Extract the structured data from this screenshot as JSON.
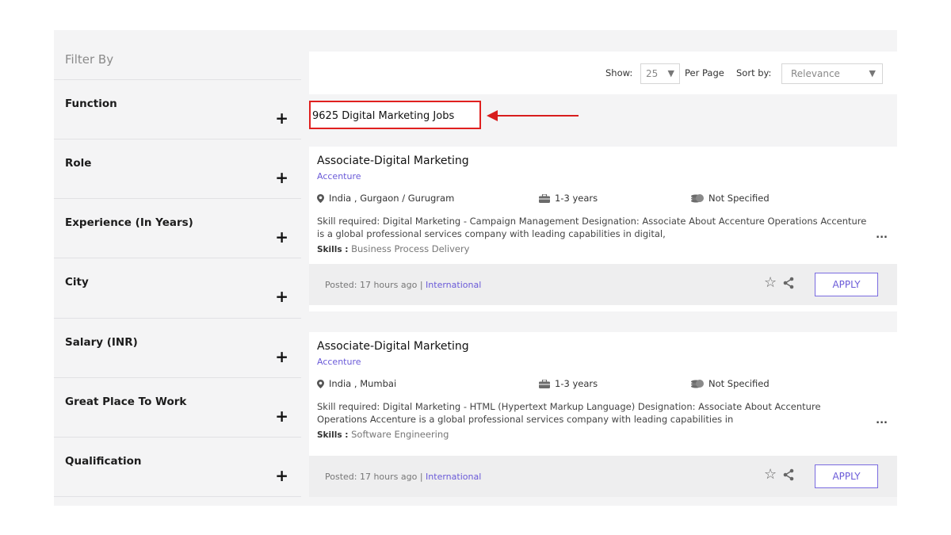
{
  "sidebar": {
    "title": "Filter By",
    "filters": [
      {
        "label": "Function"
      },
      {
        "label": "Role"
      },
      {
        "label": "Experience (In Years)"
      },
      {
        "label": "City"
      },
      {
        "label": "Salary (INR)"
      },
      {
        "label": "Great Place To Work"
      },
      {
        "label": "Qualification"
      }
    ],
    "expand_symbol": "+"
  },
  "toolbar": {
    "show_label": "Show:",
    "per_page_value": "25",
    "per_page_label": "Per Page",
    "sort_label": "Sort by:",
    "sort_value": "Relevance",
    "dropdown_arrow": "▼"
  },
  "results": {
    "count_text": "9625 Digital Marketing Jobs"
  },
  "jobs": [
    {
      "title": "Associate-Digital Marketing",
      "company": "Accenture",
      "location": "India , Gurgaon / Gurugram",
      "experience": "1-3 years",
      "salary": "Not Specified",
      "description": "Skill required: Digital Marketing - Campaign Management Designation: Associate About Accenture Operations Accenture is a global professional services company with leading capabilities in digital,",
      "skills_label": "Skills :",
      "skills": "Business Process Delivery",
      "posted": "Posted: 17 hours ago |",
      "tag": "International",
      "apply_label": "APPLY",
      "more": "..."
    },
    {
      "title": "Associate-Digital Marketing",
      "company": "Accenture",
      "location": "India , Mumbai",
      "experience": "1-3 years",
      "salary": "Not Specified",
      "description": "Skill required: Digital Marketing - HTML (Hypertext Markup Language) Designation: Associate About Accenture Operations Accenture is a global professional services company with leading capabilities in",
      "skills_label": "Skills :",
      "skills": "Software Engineering",
      "posted": "Posted: 17 hours ago |",
      "tag": "International",
      "apply_label": "APPLY",
      "more": "..."
    }
  ],
  "colors": {
    "accent": "#6a5ad8",
    "highlight_red": "#e0201f",
    "panel_bg": "#f4f4f5"
  },
  "icons": {
    "location": "map-pin-icon",
    "experience": "briefcase-icon",
    "salary": "money-stack-icon",
    "save": "star-outline-icon",
    "share": "share-icon"
  }
}
